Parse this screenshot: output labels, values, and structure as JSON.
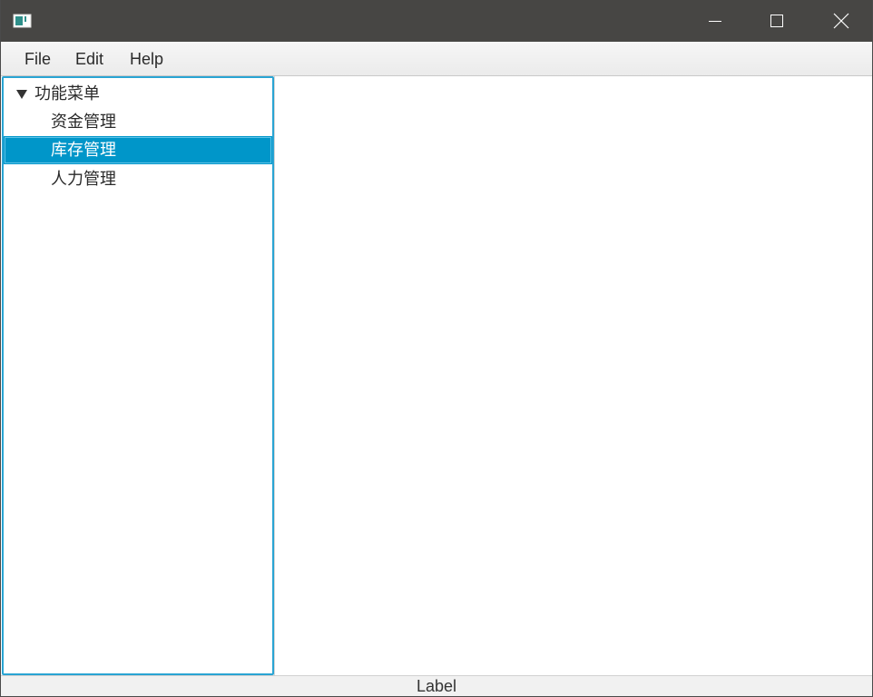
{
  "window": {
    "icon": "app-window-icon",
    "controls": {
      "minimize_icon": "minimize-icon",
      "maximize_icon": "maximize-icon",
      "close_icon": "close-icon"
    },
    "titlebar_color": "#474644"
  },
  "menubar": {
    "items": [
      {
        "label": "File"
      },
      {
        "label": "Edit"
      },
      {
        "label": "Help"
      }
    ]
  },
  "tree": {
    "root": {
      "label": "功能菜单",
      "expanded": true,
      "children": [
        {
          "label": "资金管理",
          "selected": false
        },
        {
          "label": "库存管理",
          "selected": true
        },
        {
          "label": "人力管理",
          "selected": false
        }
      ]
    },
    "focus_color": "#29a4d3",
    "selection_color": "#0096c9"
  },
  "statusbar": {
    "label": "Label"
  }
}
